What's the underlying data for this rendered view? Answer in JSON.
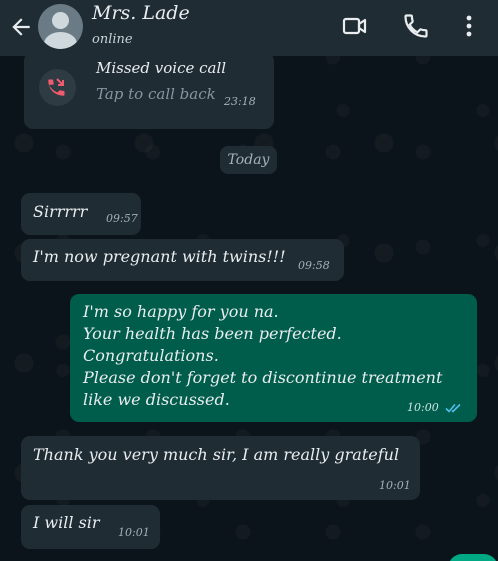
{
  "header": {
    "contact_name": "Mrs. Lade",
    "status": "online",
    "icons": [
      "back-arrow-icon",
      "video-call-icon",
      "voice-call-icon",
      "more-options-icon"
    ]
  },
  "missed_call": {
    "title": "Missed voice call",
    "subtitle": "Tap to call back",
    "time": "23:18",
    "icon": "missed-call-icon",
    "icon_color": "#f15c6d"
  },
  "date_separator": "Today",
  "messages": [
    {
      "direction": "in",
      "text": "Sirrrrr",
      "time": "09:57"
    },
    {
      "direction": "in",
      "text": "I'm now pregnant with twins!!!",
      "time": "09:58"
    },
    {
      "direction": "out",
      "lines": [
        "I'm so happy for you na.",
        "Your health has been perfected.",
        "Congratulations.",
        "Please don't forget to discontinue treatment",
        "like we discussed."
      ],
      "time": "10:00",
      "read": true
    },
    {
      "direction": "in",
      "text": "Thank you very much sir, I am really grateful",
      "time": "10:01"
    },
    {
      "direction": "in",
      "text": "I will sir",
      "time": "10:01"
    }
  ],
  "colors": {
    "background": "#0b141a",
    "header": "#1f2c34",
    "incoming_bubble": "#1f2c34",
    "outgoing_bubble": "#005c4b",
    "read_ticks": "#53bdeb",
    "accent": "#00a884"
  }
}
